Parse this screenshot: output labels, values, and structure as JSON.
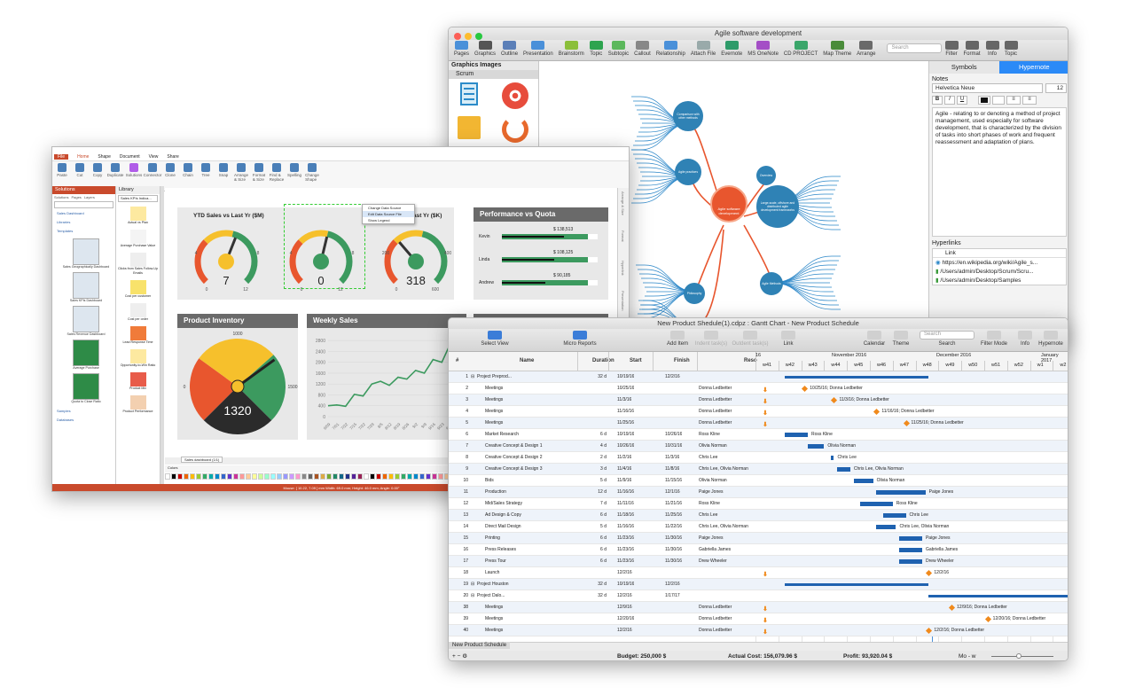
{
  "mindmap": {
    "title": "Agile software development",
    "toolbar": [
      "Pages",
      "Graphics",
      "Outline",
      "Presentation",
      "Brainstorm",
      "Topic",
      "Subtopic",
      "Callout",
      "Relationship",
      "Attach File",
      "Evernote",
      "MS OneNote",
      "CD PROJECT",
      "Map Theme",
      "Arrange",
      "Search",
      "Filter",
      "Format",
      "Info",
      "Topic"
    ],
    "search_placeholder": "Search",
    "left_header": "Graphics Images",
    "left_sub": "Scrum",
    "central": "Agile software development",
    "nodes": [
      "Comparison with other methods",
      "Agile practices",
      "Overview",
      "Large-scale, offshore and distributed agile development frameworks",
      "Philosophy",
      "Agile Methods",
      "Agile methods and frameworks"
    ],
    "tabs": [
      "Symbols",
      "Hypernote"
    ],
    "notes_label": "Notes",
    "font": "Helvetica Neue",
    "font_size": "12",
    "note_text": "Agile - relating to or denoting a method of project management, used especially for software development, that is characterized by the division of tasks into short phases of work and frequent reassessment and adaptation of plans.",
    "hyperlinks_label": "Hyperlinks",
    "link_col": "Link",
    "links": [
      "https://en.wikipedia.org/wiki/Agile_s...",
      "/Users/admin/Desktop/Scrum/Scru...",
      "/Users/admin/Desktop/Samples"
    ]
  },
  "dashboard": {
    "tabs": [
      "File",
      "Home",
      "Shape",
      "Document",
      "View",
      "Share"
    ],
    "ribbon_groups": [
      "Clipboard",
      "Text Format",
      "Solutions",
      "AI",
      "Select",
      "Tools",
      "Flowchart",
      "Panels",
      "Editing"
    ],
    "ribbon_buttons": [
      "Paste",
      "Cut",
      "Copy",
      "Duplicate",
      "Solutions",
      "Connector",
      "Clone",
      "Chain",
      "Tree",
      "Snap",
      "Arrange & Size",
      "Format & Size",
      "Find & Replace",
      "Spelling",
      "Change Shape"
    ],
    "solutions_title": "Solutions",
    "solutions_tabs": [
      "Solutions",
      "Pages",
      "Layers"
    ],
    "solutions_items": [
      "Sales Dashboard",
      "Libraries",
      "Templates",
      "Samples",
      "Databases"
    ],
    "templates": [
      "Sales Geographically Dashboard",
      "Sales KPIs Dashboard",
      "Sales Revenue Dashboard",
      "Average Purchase",
      "Quota to Close Ratio"
    ],
    "library_title": "Library",
    "library_sel": "Sales KPIs Indica...",
    "library_items": [
      "Actual vs Plan",
      "Average Purchase Value",
      "Clicks from Sales Follow-Up Emails",
      "Cost per customer",
      "Cost per order",
      "Lead Response Time",
      "Opportunity-to-Win Ratio",
      "Product Mix",
      "Product Performance"
    ],
    "gauge_title": "YTD Sales vs Last Yr ($M)",
    "gauge_title2": "Last Yr ($K)",
    "gauges": [
      {
        "value": "7",
        "min": "0",
        "max": "12",
        "lo": "4",
        "hi": "8",
        "level": 0.58
      },
      {
        "value": "0",
        "min": "0",
        "max": "12",
        "lo": "4",
        "hi": "8",
        "level": 0.55
      },
      {
        "value": "318",
        "min": "0",
        "max": "600",
        "lo": "200",
        "hi": "400",
        "level": 0.35
      }
    ],
    "context_menu": [
      "Change Data Source",
      "Edit Data Source File",
      "Show Legend"
    ],
    "perf_title": "Performance vs Quota",
    "perf": [
      {
        "name": "Kevin",
        "val": "$ 138,513",
        "level": 0.65,
        "quota": 0.9
      },
      {
        "name": "Linda",
        "val": "$ 108,125",
        "level": 0.55,
        "quota": 0.9
      },
      {
        "name": "Andrew",
        "val": "$ 90,185",
        "level": 0.45,
        "quota": 0.9
      }
    ],
    "inventory_title": "Product Inventory",
    "inventory_value": "1320",
    "inventory_ticks": [
      "0",
      "1000",
      "1500"
    ],
    "inventory_level": 0.7,
    "weekly_title": "Weekly Sales",
    "page_tab": "Sales dashboard (1/1)",
    "colors_label": "Colors",
    "side_tabs": [
      "Arrange & Size",
      "Format",
      "Hyperlink",
      "Presentation"
    ],
    "status": "Mouse: [ 10.22, 7.09 ] mm  Width: 69.0 mm; Height: 46.0 mm; Angle: 0.00°"
  },
  "weekly_chart": {
    "chart_data": {
      "type": "line",
      "x": [
        "6/9",
        "6/16",
        "6/23",
        "6/30",
        "7/7",
        "7/14",
        "7/21",
        "7/28",
        "8/4",
        "8/11",
        "8/18",
        "8/25",
        "9/1",
        "9/8",
        "9/15",
        "9/22"
      ],
      "values": [
        400,
        430,
        380,
        820,
        760,
        1200,
        1300,
        1150,
        1450,
        1380,
        1700,
        1600,
        2100,
        2000,
        2700,
        2950
      ],
      "ylim": [
        0,
        3000
      ],
      "yticks": [
        "0",
        "400",
        "800",
        "1200",
        "1600",
        "2000",
        "2400",
        "2800"
      ],
      "xticks": [
        "6/09",
        "7/01",
        "7/22",
        "7/15",
        "7/22",
        "7/29",
        "8/5",
        "8/12",
        "8/19",
        "8/26",
        "9/2",
        "9/9",
        "9/16",
        "9/23",
        "9/30",
        "10/7"
      ]
    }
  },
  "gantt": {
    "title": "New Product Shedule(1).cdpz : Gantt Chart - New Product Schedule",
    "toolbar": [
      "Select View",
      "Micro Reports",
      "Add Item",
      "Indent task(s)",
      "Outdent task(s)",
      "Link",
      "Calendar",
      "Theme",
      "Search",
      "Filter Mode",
      "Info",
      "Hypernote"
    ],
    "search_placeholder": "Search",
    "cols": [
      "#",
      "Name",
      "Duration",
      "Start",
      "Finish",
      "Reso"
    ],
    "months": [
      "16",
      "November 2016",
      "December 2016",
      "January 2017"
    ],
    "weeks": [
      "w41",
      "w42",
      "w43",
      "w44",
      "w45",
      "w46",
      "w47",
      "w48",
      "w49",
      "w50",
      "w51",
      "w52",
      "w1",
      "w2"
    ],
    "rows": [
      {
        "n": "1",
        "name": "Project Preprod...",
        "d": "32 d",
        "s": "10/19/16",
        "f": "12/2/16",
        "r": "",
        "group": true
      },
      {
        "n": "2",
        "name": "Meetings",
        "d": "",
        "s": "10/25/16",
        "f": "",
        "r": "Donna Ledbetter"
      },
      {
        "n": "3",
        "name": "Meetings",
        "d": "",
        "s": "11/3/16",
        "f": "",
        "r": "Donna Ledbetter"
      },
      {
        "n": "4",
        "name": "Meetings",
        "d": "",
        "s": "11/16/16",
        "f": "",
        "r": "Donna Ledbetter"
      },
      {
        "n": "5",
        "name": "Meetings",
        "d": "",
        "s": "11/25/16",
        "f": "",
        "r": "Donna Ledbetter"
      },
      {
        "n": "6",
        "name": "Market Research",
        "d": "6 d",
        "s": "10/19/16",
        "f": "10/26/16",
        "r": "Ross Kline"
      },
      {
        "n": "7",
        "name": "Creative Concept & Design 1",
        "d": "4 d",
        "s": "10/26/16",
        "f": "10/31/16",
        "r": "Olivia Norman"
      },
      {
        "n": "8",
        "name": "Creative Concept & Design 2",
        "d": "2 d",
        "s": "11/2/16",
        "f": "11/3/16",
        "r": "Chris Lee"
      },
      {
        "n": "9",
        "name": "Creative Concept & Design 3",
        "d": "3 d",
        "s": "11/4/16",
        "f": "11/8/16",
        "r": "Chris Lee, Olivia Norman"
      },
      {
        "n": "10",
        "name": "Bids",
        "d": "5 d",
        "s": "11/9/16",
        "f": "11/15/16",
        "r": "Olivia Norman"
      },
      {
        "n": "11",
        "name": "Production",
        "d": "12 d",
        "s": "11/16/16",
        "f": "12/1/16",
        "r": "Paige Jones"
      },
      {
        "n": "12",
        "name": "Mid/Sales Strategy",
        "d": "7 d",
        "s": "11/11/16",
        "f": "11/21/16",
        "r": "Ross Kline"
      },
      {
        "n": "13",
        "name": "Ad Design & Copy",
        "d": "6 d",
        "s": "11/18/16",
        "f": "11/25/16",
        "r": "Chris Lee"
      },
      {
        "n": "14",
        "name": "Direct Mail Design",
        "d": "5 d",
        "s": "11/16/16",
        "f": "11/22/16",
        "r": "Chris Lee, Olivia Norman"
      },
      {
        "n": "15",
        "name": "Printing",
        "d": "6 d",
        "s": "11/23/16",
        "f": "11/30/16",
        "r": "Paige Jones"
      },
      {
        "n": "16",
        "name": "Press Releases",
        "d": "6 d",
        "s": "11/23/16",
        "f": "11/30/16",
        "r": "Gabriella James"
      },
      {
        "n": "17",
        "name": "Press Tour",
        "d": "6 d",
        "s": "11/23/16",
        "f": "11/30/16",
        "r": "Drew Wheeler"
      },
      {
        "n": "18",
        "name": "Launch",
        "d": "",
        "s": "12/2/16",
        "f": "",
        "r": ""
      },
      {
        "n": "19",
        "name": "Project Houston",
        "d": "32 d",
        "s": "10/19/16",
        "f": "12/2/16",
        "r": "",
        "group": true
      },
      {
        "n": "20",
        "name": "Project Dalo...",
        "d": "32 d",
        "s": "12/2/16",
        "f": "1/17/17",
        "r": "",
        "group": true
      },
      {
        "n": "38",
        "name": "Meetings",
        "d": "",
        "s": "12/9/16",
        "f": "",
        "r": "Donna Ledbetter"
      },
      {
        "n": "39",
        "name": "Meetings",
        "d": "",
        "s": "12/20/16",
        "f": "",
        "r": "Donna Ledbetter"
      },
      {
        "n": "40",
        "name": "Meetings",
        "d": "",
        "s": "12/2/16",
        "f": "",
        "r": "Donna Ledbetter"
      }
    ],
    "timeline_labels": [
      "Ross Kline",
      "Olivia Norman",
      "Chris Lee",
      "Chris Lee, Olivia Norman",
      "Olivia Norman",
      "Paige Jones",
      "Ross Kline",
      "Chris Lee",
      "Chris Lee, Olivia Norman",
      "Paige Jones",
      "Gabriella James",
      "Drew Wheeler",
      "12/2/16"
    ],
    "milestones": [
      "10/25/16; Donna Ledbetter",
      "11/3/16; Donna Ledbetter",
      "11/16/16; Donna Ledbetter",
      "11/25/16; Donna Ledbetter",
      "12/9/16; Donna Ledbetter",
      "12/20/16; Donna Ledbetter",
      "12/2/16; Donna Ledbetter"
    ],
    "sheet_tab": "New Product Schedule",
    "budget": "Budget: 250,000 $",
    "actual": "Actual Cost: 156,079.96 $",
    "profit": "Profit: 93,920.04 $",
    "zoom": "Mo - w"
  }
}
